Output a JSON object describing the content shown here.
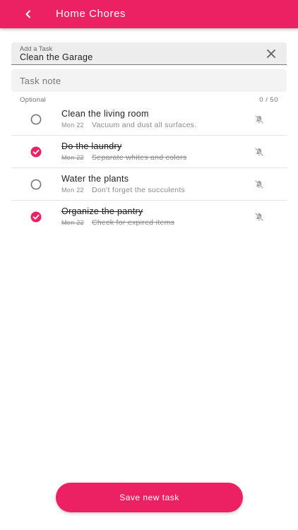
{
  "appbar": {
    "title": "Home Chores",
    "back_icon": "chevron-left-icon",
    "color": "#ec2163"
  },
  "task_input": {
    "label": "Add a Task",
    "value": "Clean the Garage",
    "clear_icon": "close-icon"
  },
  "note_field": {
    "placeholder": "Task note",
    "helper_text": "Optional",
    "counter": "0 / 50"
  },
  "tasks": [
    {
      "title": "Clean the living room",
      "date": "Mon 22",
      "note": "Vacuum and dust all surfaces.",
      "completed": false
    },
    {
      "title": "Do the laundry",
      "date": "Mon 22",
      "note": "Separate whites and colors",
      "completed": true
    },
    {
      "title": "Water the plants",
      "date": "Mon 22",
      "note": "Don't forget the succulents",
      "completed": false
    },
    {
      "title": "Organize the pantry",
      "date": "Mon 22",
      "note": "Check for expired items",
      "completed": true
    }
  ],
  "save_button": {
    "label": "Save new task"
  },
  "colors": {
    "accent": "#ec2163",
    "unchecked": "#757575",
    "bell": "#9e9e9e"
  }
}
